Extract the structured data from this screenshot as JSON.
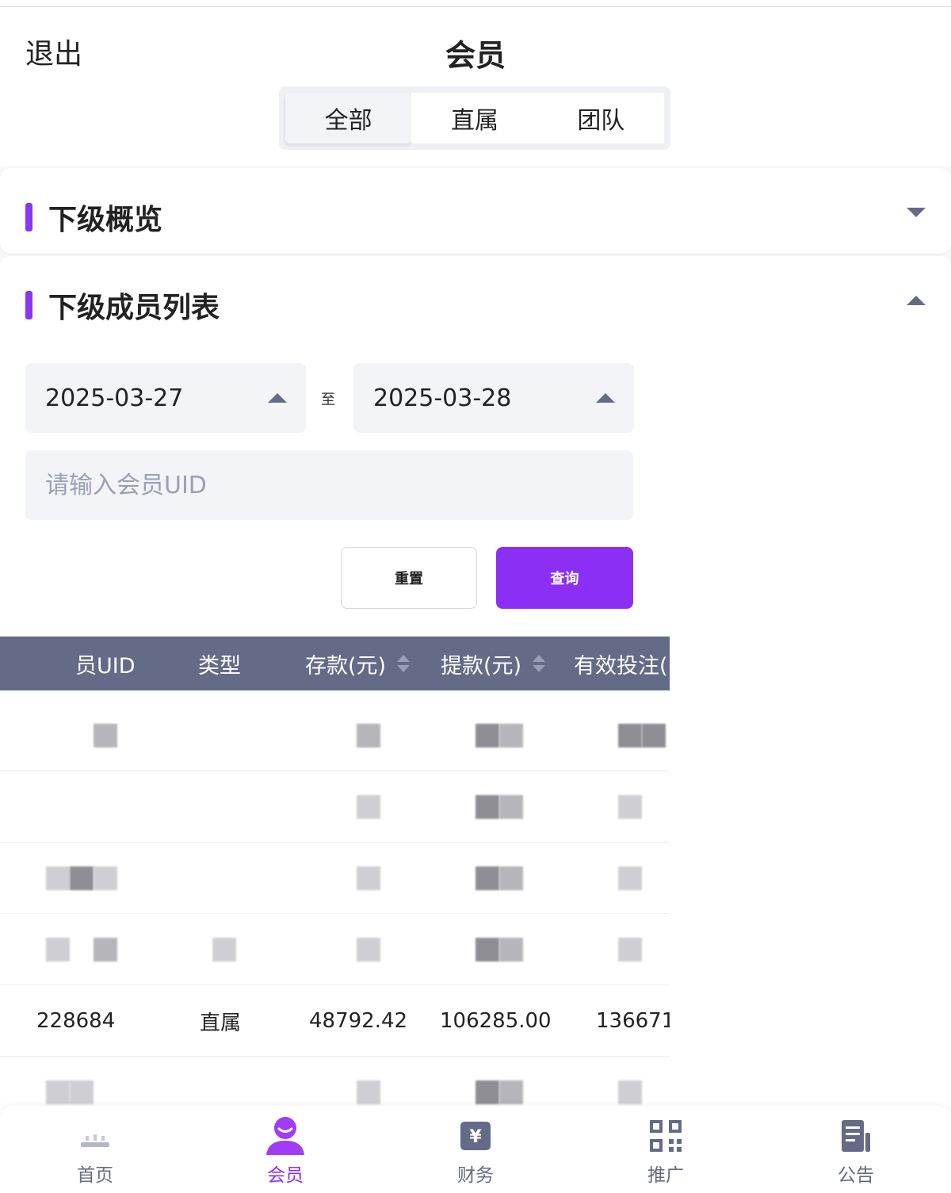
{
  "header": {
    "back_label": "退出",
    "title": "会员",
    "tabs": [
      {
        "label": "全部",
        "active": true
      },
      {
        "label": "直属",
        "active": false
      },
      {
        "label": "团队",
        "active": false
      }
    ]
  },
  "overview": {
    "title": "下级概览",
    "expanded": false
  },
  "members": {
    "title": "下级成员列表",
    "expanded": true,
    "start_date": "2025-03-27",
    "to_label": "至",
    "end_date": "2025-03-28",
    "uid_placeholder": "请输入会员UID",
    "reset_label": "重置",
    "query_label": "查询"
  },
  "table": {
    "columns": [
      "员UID",
      "类型",
      "存款(元)",
      "提款(元)",
      "有效投注("
    ],
    "visible_row": {
      "uid": "228684",
      "type": "直属",
      "deposit": "48792.42",
      "withdraw": "106285.00",
      "bet": "136671."
    }
  },
  "tabbar": [
    {
      "label": "首页",
      "icon": "home-icon",
      "active": false
    },
    {
      "label": "会员",
      "icon": "member-icon",
      "active": true
    },
    {
      "label": "财务",
      "icon": "finance-icon",
      "active": false
    },
    {
      "label": "推广",
      "icon": "qrcode-icon",
      "active": false
    },
    {
      "label": "公告",
      "icon": "notice-icon",
      "active": false
    }
  ],
  "colors": {
    "accent": "#8b2ff5",
    "table_header": "#646b86",
    "icon_gray": "#646b86"
  }
}
